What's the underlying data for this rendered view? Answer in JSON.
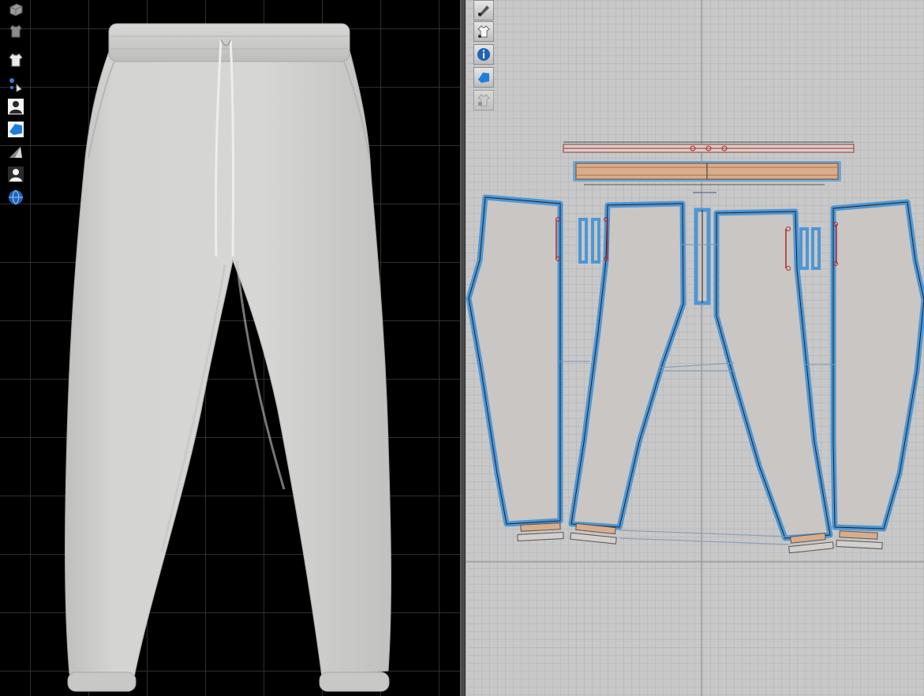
{
  "toolbar_3d": {
    "tools": [
      {
        "name": "avatar-box-icon"
      },
      {
        "name": "garment-texture-icon"
      },
      {
        "name": "show-garment-icon"
      },
      {
        "name": "pins-icon"
      },
      {
        "name": "show-avatar-icon"
      },
      {
        "name": "pattern-surface-icon"
      },
      {
        "name": "fabric-shading-icon"
      },
      {
        "name": "avatar-silhouette-icon"
      },
      {
        "name": "environment-globe-icon"
      }
    ]
  },
  "toolbar_2d": {
    "tools": [
      {
        "name": "edit-pattern-icon"
      },
      {
        "name": "show-garment-2d-icon"
      },
      {
        "name": "info-icon"
      },
      {
        "name": "show-pattern-icon"
      },
      {
        "name": "locked-garment-icon"
      }
    ]
  },
  "colors": {
    "grid_3d": "#2f2f2f",
    "viewport_2d_bg": "#c8c8c8",
    "garment_fabric": "#d3d3d1",
    "pattern_fill": "#c9c6c4",
    "pattern_outline": "#4d97d6",
    "waistband_fill": "#d9ad8a",
    "seam_red": "#b02a2a"
  }
}
